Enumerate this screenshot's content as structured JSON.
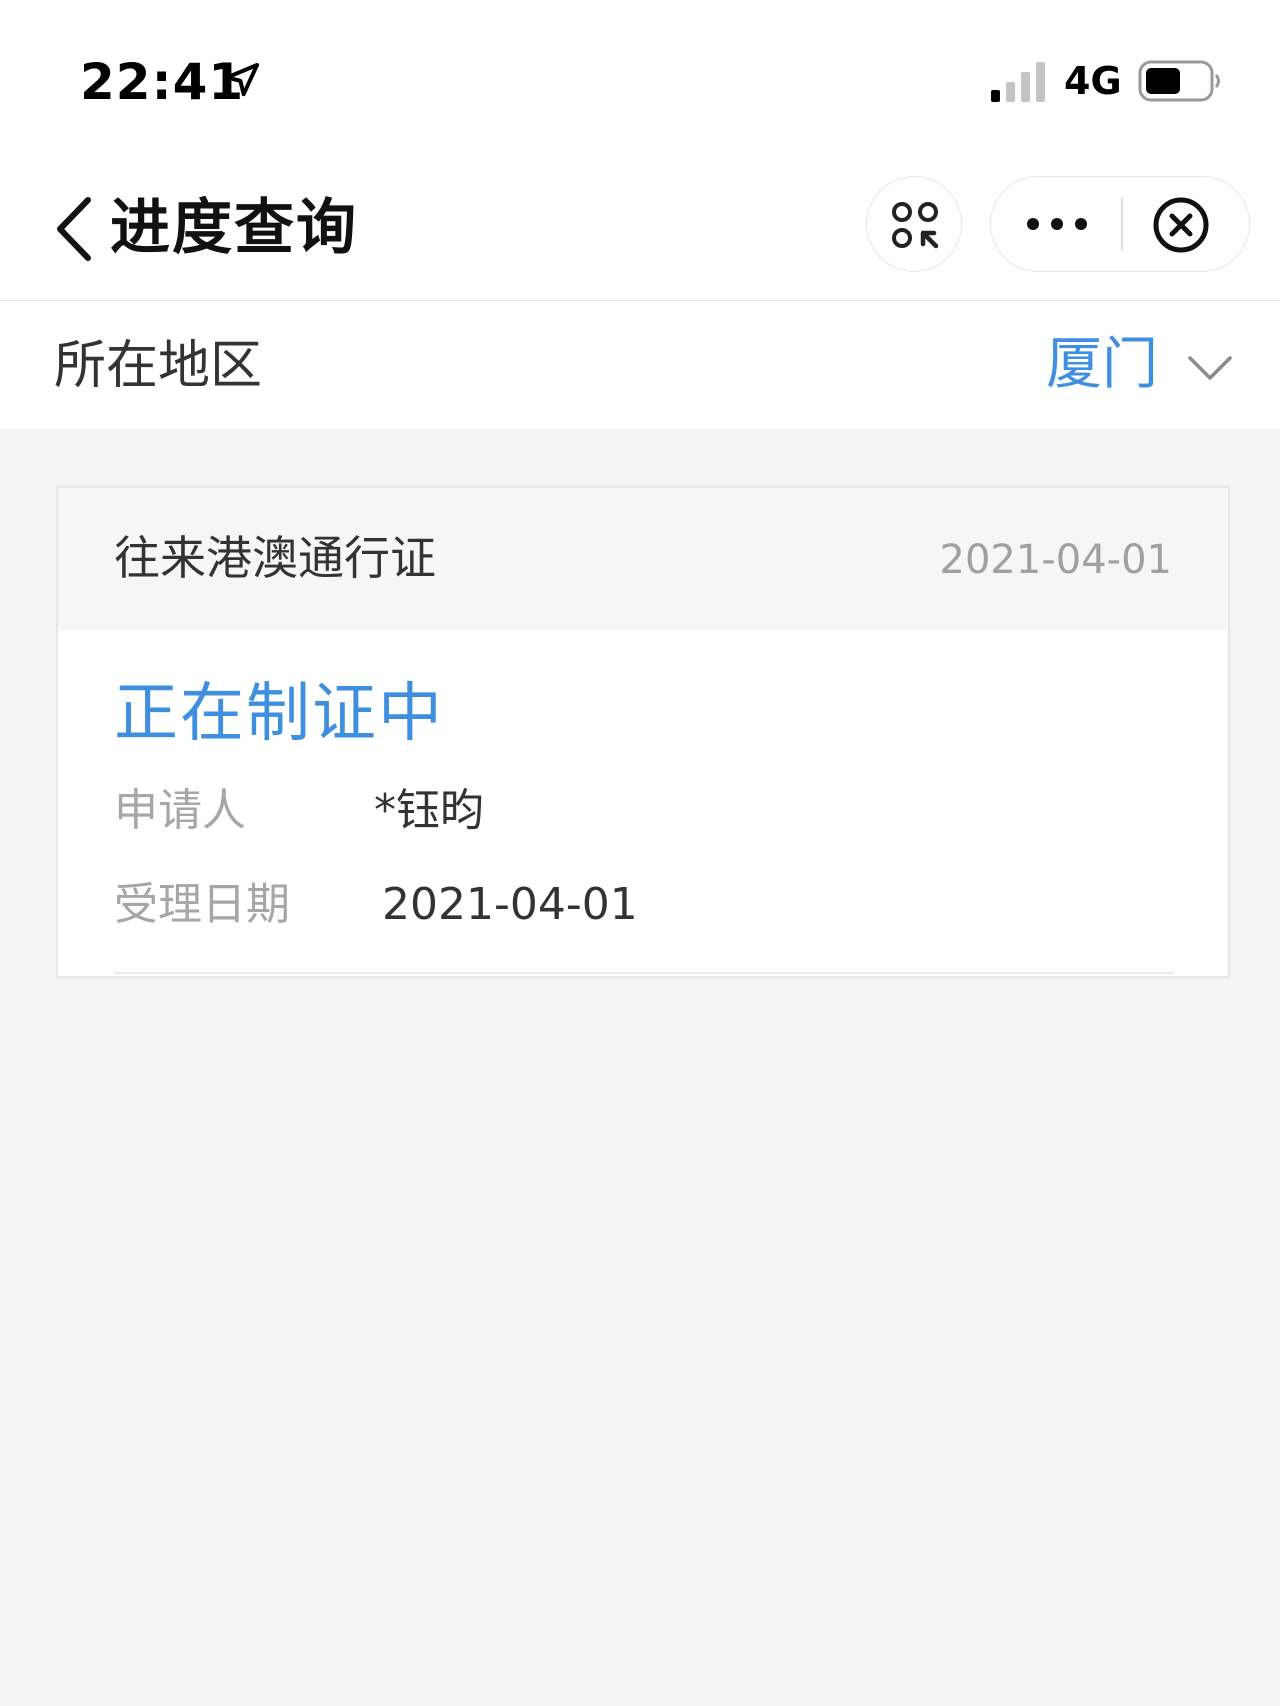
{
  "status_bar": {
    "time": "22:41",
    "network": "4G",
    "icons": [
      "location-arrow-icon",
      "signal-icon",
      "battery-icon"
    ]
  },
  "nav": {
    "title": "进度查询",
    "icons": [
      "back-icon",
      "mini-program-icon",
      "more-icon",
      "close-icon"
    ]
  },
  "region": {
    "label": "所在地区",
    "value": "厦门",
    "icon": "chevron-down-icon"
  },
  "record": {
    "type": "往来港澳通行证",
    "date": "2021-04-01",
    "status": "正在制证中",
    "fields": [
      {
        "label": "申请人",
        "value": "*钰昀"
      },
      {
        "label": "受理日期",
        "value": "2021-04-01"
      }
    ]
  },
  "colors": {
    "accent": "#3f8fe0",
    "page_background": "#f4f4f4",
    "card_header_background": "#f6f6f6",
    "muted_text": "#a6a6a6",
    "primary_text": "#333333"
  }
}
